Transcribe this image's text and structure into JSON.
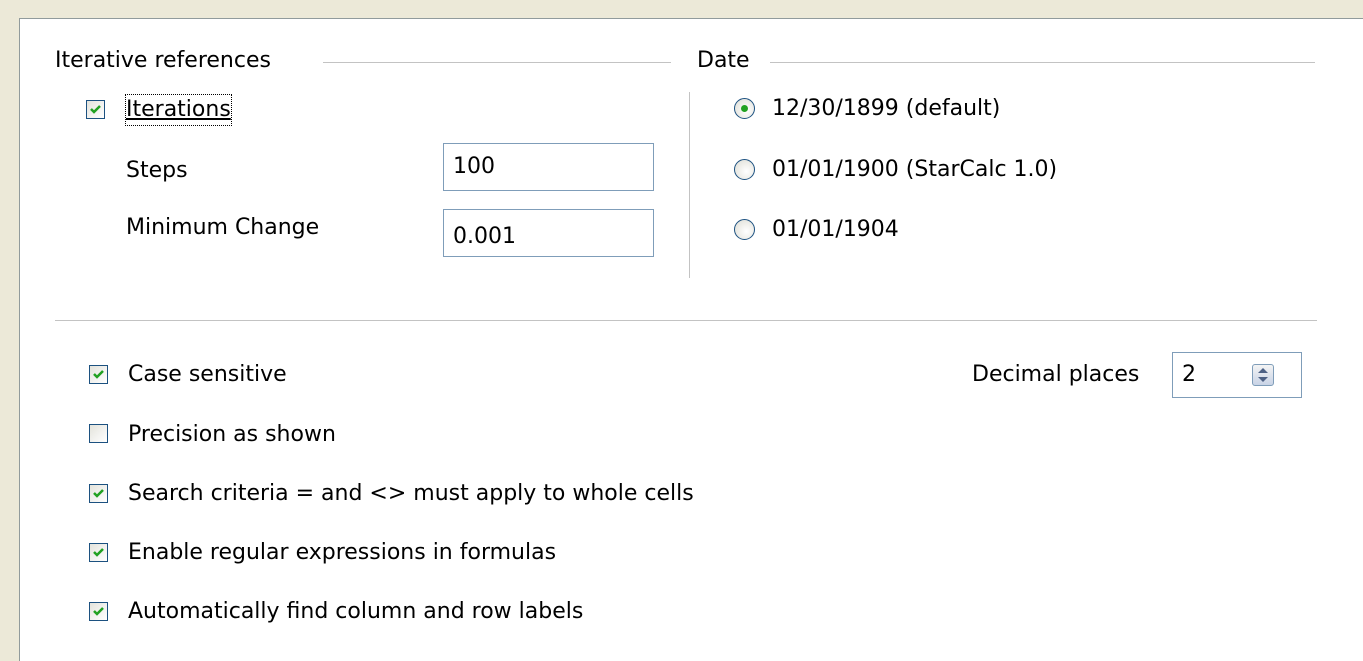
{
  "iterative": {
    "heading": "Iterative references",
    "iterations_label": "Iterations",
    "iterations_checked": true,
    "steps_label": "Steps",
    "steps_value": "100",
    "min_change_label": "Minimum Change",
    "min_change_value": "0.001"
  },
  "date": {
    "heading": "Date",
    "options": [
      {
        "label": "12/30/1899 (default)",
        "selected": true
      },
      {
        "label": "01/01/1900 (StarCalc 1.0)",
        "selected": false
      },
      {
        "label": "01/01/1904",
        "selected": false
      }
    ]
  },
  "options": [
    {
      "label": "Case sensitive",
      "checked": true
    },
    {
      "label": "Precision as shown",
      "checked": false
    },
    {
      "label": "Search criteria = and <> must apply to whole cells",
      "checked": true
    },
    {
      "label": "Enable regular expressions in formulas",
      "checked": true
    },
    {
      "label": "Automatically find column and row labels",
      "checked": true
    }
  ],
  "decimal": {
    "label": "Decimal places",
    "value": "2"
  },
  "colors": {
    "checkmark": "#21a121",
    "border": "#1c5180",
    "field_border": "#7f9db9"
  }
}
